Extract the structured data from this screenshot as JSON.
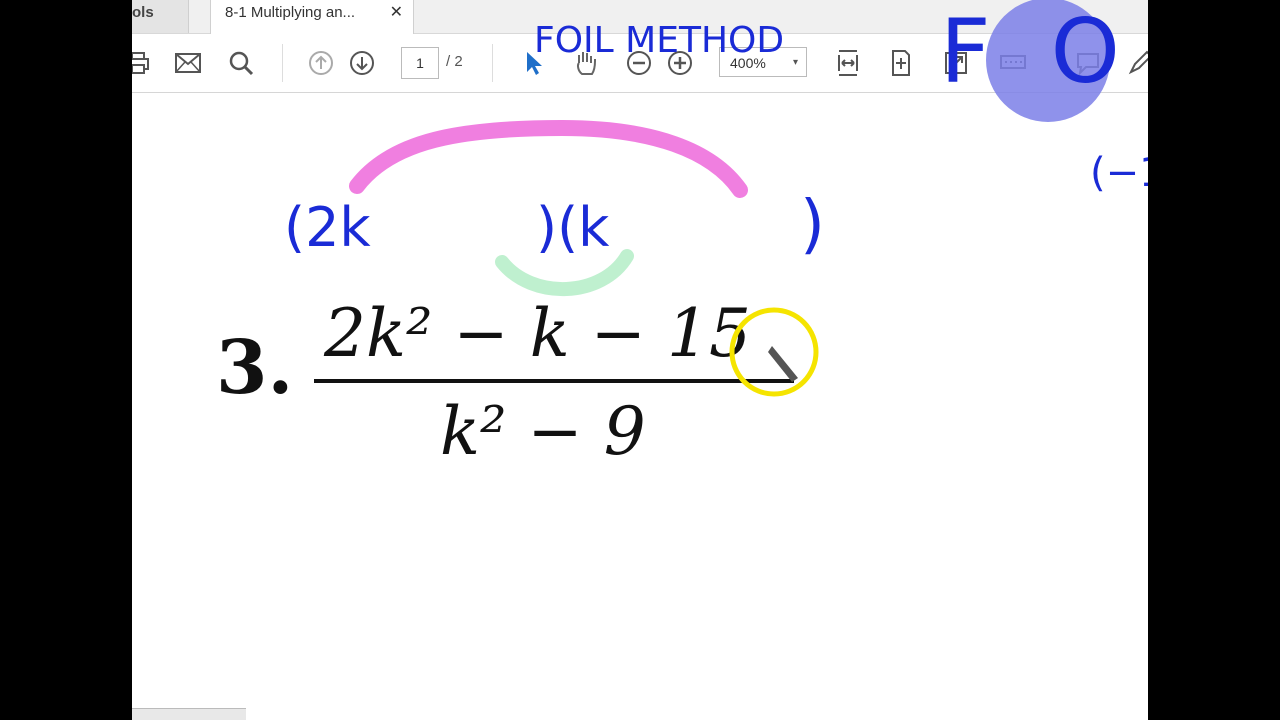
{
  "tabs": {
    "tools_label": "ols",
    "doc_title": "8-1 Multiplying an...",
    "close_glyph": "✕"
  },
  "toolbar": {
    "print_icon": "printer-icon",
    "email_icon": "envelope-icon",
    "search_icon": "magnifier-icon",
    "prev_page_icon": "arrow-up-circle-icon",
    "next_page_icon": "arrow-down-circle-icon",
    "page_current": "1",
    "page_total": "/ 2",
    "zoom_value": "400%",
    "zoom_caret": "▾"
  },
  "document": {
    "problem_number": "3.",
    "numerator": "2k² − k − 15",
    "denominator": "k² − 9"
  },
  "annotations": {
    "header_note": "FOIL METHOD",
    "big_letters": "F O I L",
    "factor_open": "(2k",
    "factor_mid": ")(k",
    "factor_close": ")",
    "side_note": "(−1"
  },
  "colors": {
    "ink_blue": "#1a2bd6",
    "highlight_pink": "#f07fe0",
    "highlight_green": "#bff0cf",
    "cursor_yellow": "#f5e400",
    "spotlight_purple": "#7b7fe8"
  }
}
